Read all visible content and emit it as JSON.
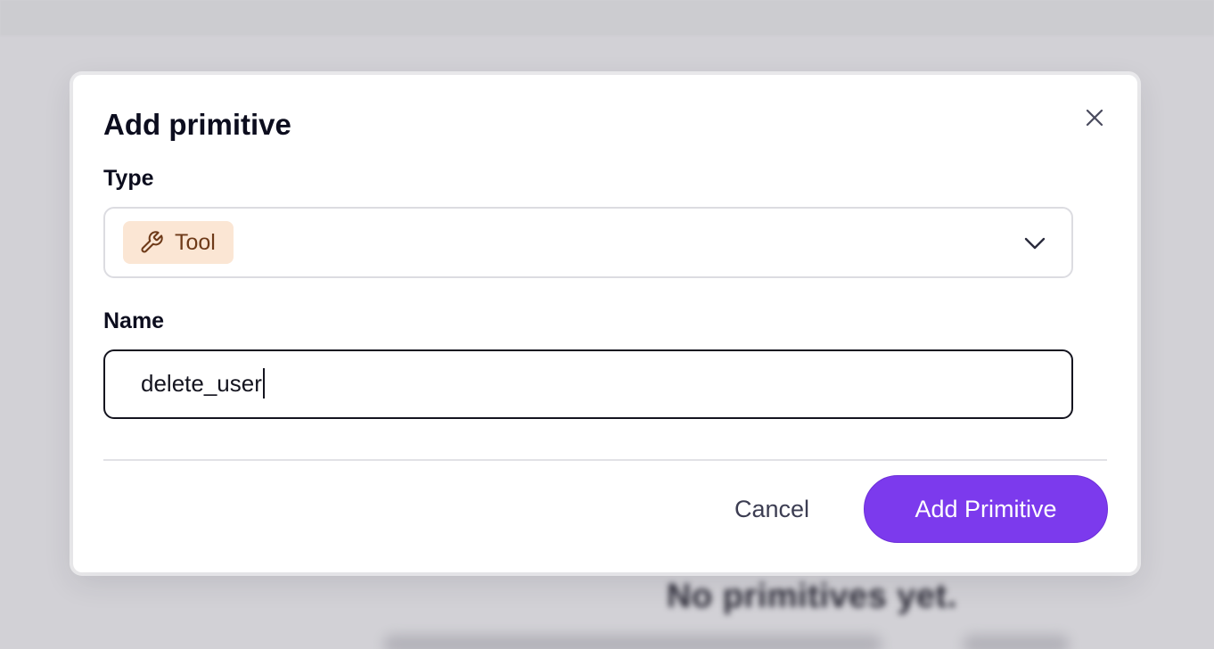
{
  "background": {
    "empty_state_text": "No primitives yet."
  },
  "dialog": {
    "title": "Add primitive",
    "close_icon": "close-icon",
    "type_field": {
      "label": "Type",
      "selected_value": "Tool",
      "selected_icon": "wrench-icon",
      "dropdown_icon": "chevron-down-icon"
    },
    "name_field": {
      "label": "Name",
      "value": "delete_user"
    },
    "buttons": {
      "cancel_label": "Cancel",
      "submit_label": "Add Primitive"
    }
  },
  "colors": {
    "overlay_background": "#d2d1d6",
    "primary_button": "#7c3aed",
    "chip_background": "#fbe6d4",
    "chip_text": "#6e3a18"
  }
}
